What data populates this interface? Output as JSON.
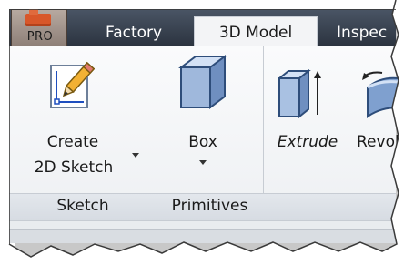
{
  "tabs": {
    "app_button": "PRO",
    "factory": "Factory",
    "model": "3D Model",
    "inspect": "Inspec"
  },
  "tools": {
    "create_sketch_line1": "Create",
    "create_sketch_line2": "2D Sketch",
    "box": "Box",
    "extrude": "Extrude",
    "revolve": "Revol"
  },
  "groups": {
    "sketch": "Sketch",
    "primitives": "Primitives"
  },
  "icons": {
    "create_sketch": "pencil-sketch-icon",
    "box": "cube-icon",
    "extrude": "extrude-icon",
    "revolve": "revolve-icon",
    "dropdown": "dropdown-arrow-icon"
  },
  "colors": {
    "tab_bar": "#3a4350",
    "active_tab": "#f3f4f6",
    "ribbon": "#f4f6f8",
    "cube_face": "#9fb8dc",
    "cube_edge": "#2e4d7a"
  }
}
